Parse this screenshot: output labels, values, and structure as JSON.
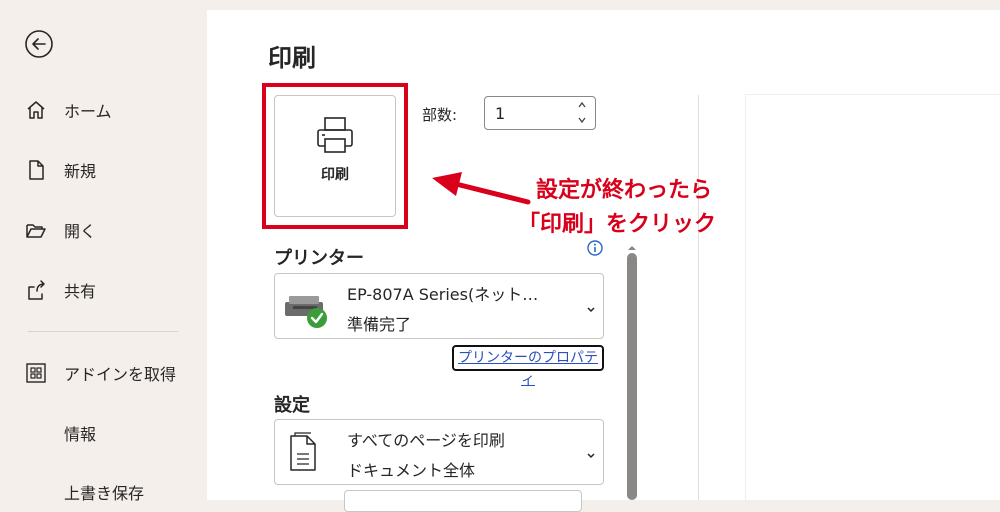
{
  "nav": {
    "items": [
      {
        "label": "ホーム",
        "icon": "home-icon"
      },
      {
        "label": "新規",
        "icon": "new-document-icon"
      },
      {
        "label": "開く",
        "icon": "open-folder-icon"
      },
      {
        "label": "共有",
        "icon": "share-icon"
      },
      {
        "label": "アドインを取得",
        "icon": "addins-grid-icon"
      },
      {
        "label": "情報"
      },
      {
        "label": "上書き保存"
      }
    ]
  },
  "print": {
    "title": "印刷",
    "button_label": "印刷",
    "copies_label": "部数:",
    "copies_value": "1"
  },
  "printer": {
    "section_title": "プリンター",
    "name": "EP-807A Series(ネット…",
    "status": "準備完了",
    "properties_link": "プリンターのプロパティ"
  },
  "settings": {
    "section_title": "設定",
    "scope_line1": "すべてのページを印刷",
    "scope_line2": "ドキュメント全体"
  },
  "annotation": {
    "line1": "設定が終わったら",
    "line2": "「印刷」をクリック",
    "color": "#d9001b"
  }
}
